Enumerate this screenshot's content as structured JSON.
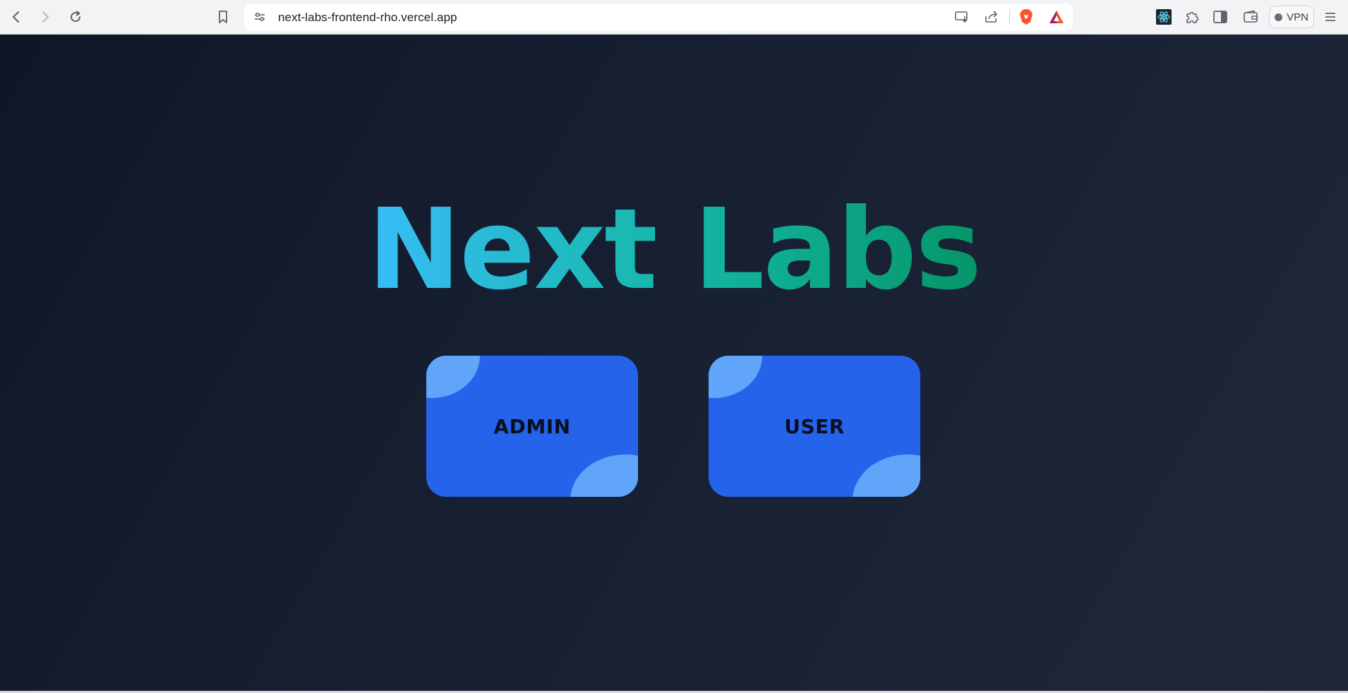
{
  "browser": {
    "url": "next-labs-frontend-rho.vercel.app",
    "vpn_label": "VPN",
    "icons": {
      "back": "chevron-left-icon",
      "forward": "chevron-right-icon",
      "reload": "reload-icon",
      "bookmark": "bookmark-icon",
      "site_settings": "site-settings-icon",
      "install": "install-app-icon",
      "share": "share-icon",
      "brave_shields": "brave-shield-icon",
      "rewards": "brave-rewards-icon",
      "react_devtools": "react-icon",
      "extensions": "puzzle-icon",
      "sidebar": "sidebar-icon",
      "wallet": "wallet-icon",
      "menu": "hamburger-menu-icon"
    }
  },
  "page": {
    "title": "Next Labs",
    "title_gradient": [
      "#38bdf8",
      "#14b8a6",
      "#059669"
    ],
    "background": "#172033",
    "cards": [
      {
        "label": "ADMIN",
        "color": "#2563eb",
        "accent": "#60a5fa"
      },
      {
        "label": "USER",
        "color": "#2563eb",
        "accent": "#60a5fa"
      }
    ]
  }
}
